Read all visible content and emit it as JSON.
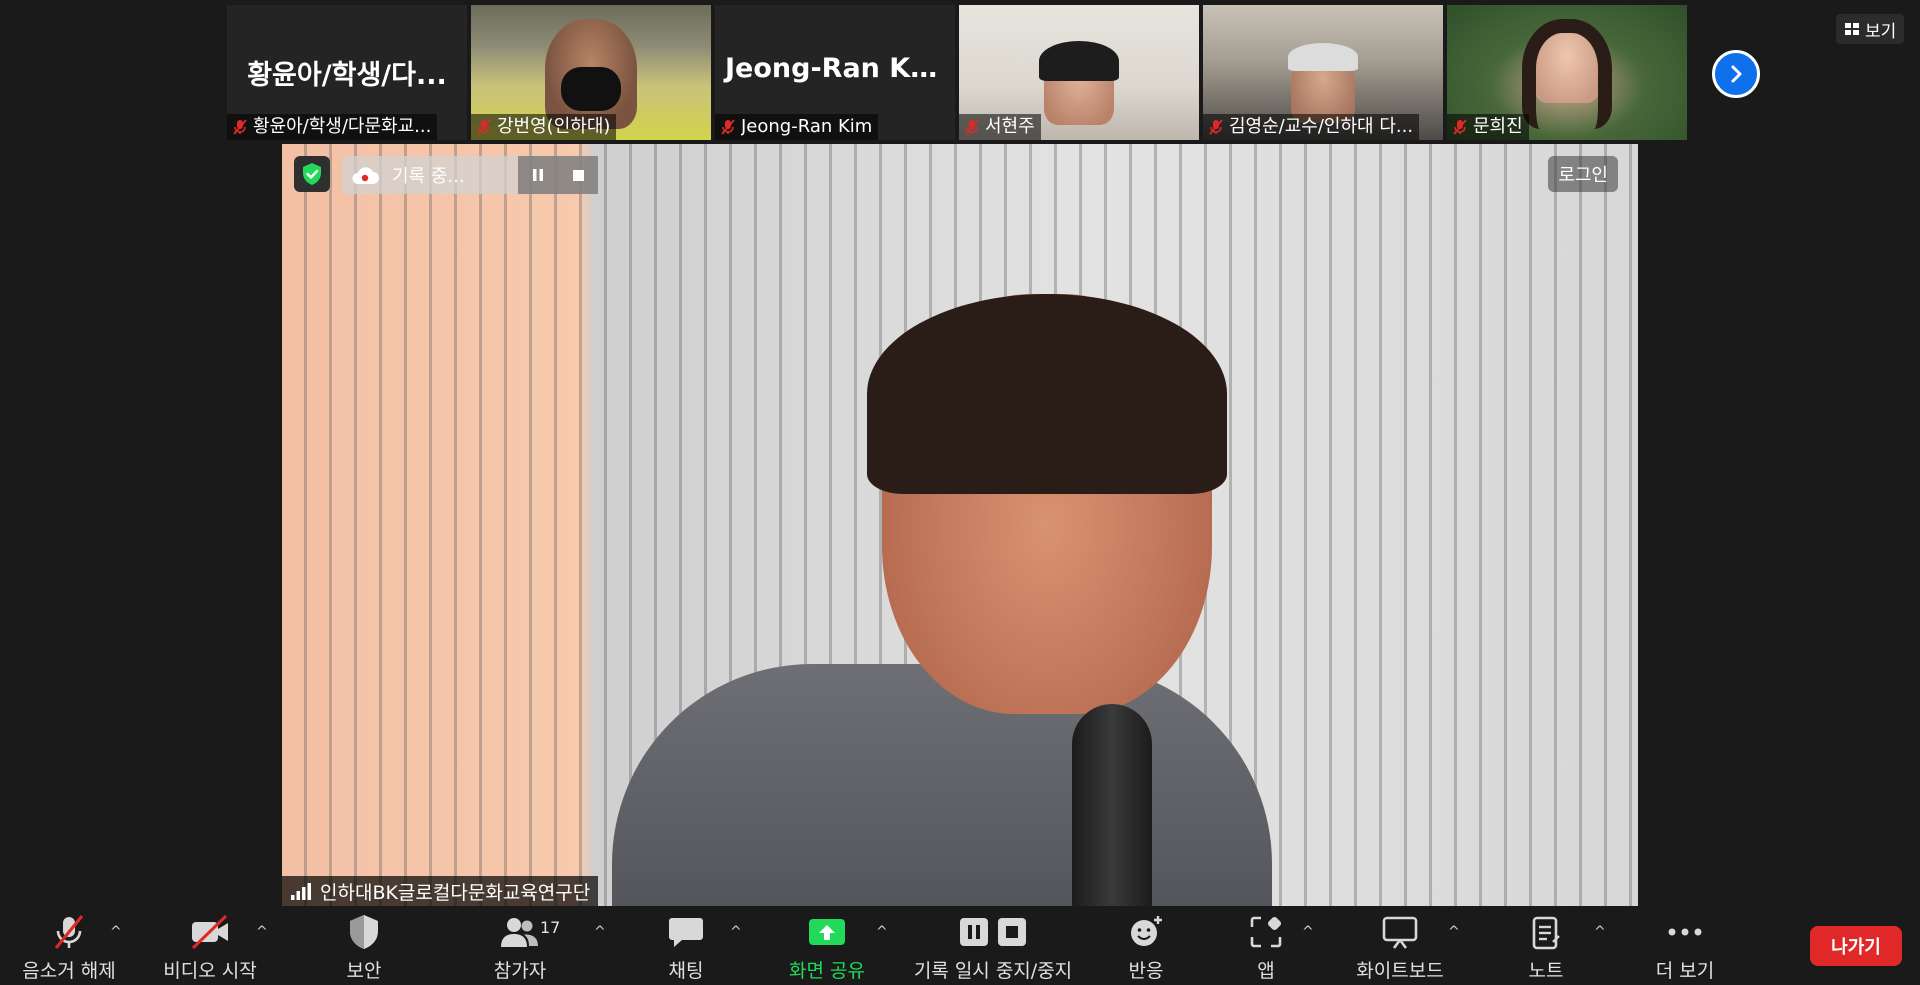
{
  "participants": [
    {
      "name": "황윤아/학생/다문화교...",
      "big_name": "황윤아/학생/다...",
      "video": false
    },
    {
      "name": "강번영(인하대)",
      "video": true
    },
    {
      "name": "Jeong-Ran Kim",
      "big_name": "Jeong-Ran Kim",
      "video": false
    },
    {
      "name": "서현주",
      "video": true
    },
    {
      "name": "김영순/교수/인하대 다...",
      "video": true
    },
    {
      "name": "문희진",
      "video": true
    }
  ],
  "view_label": "보기",
  "main": {
    "recording_label": "기록 중...",
    "login_label": "로그인",
    "speaker_name": "인하대BK글로컬다문화교육연구단"
  },
  "toolbar": {
    "unmute": "음소거 해제",
    "start_video": "비디오 시작",
    "security": "보안",
    "participants": "참가자",
    "participants_count": "17",
    "chat": "채팅",
    "share_screen": "화면 공유",
    "recording": "기록 일시 중지/중지",
    "reactions": "반응",
    "apps": "앱",
    "whiteboard": "화이트보드",
    "notes": "노트",
    "more": "더 보기",
    "leave": "나가기"
  },
  "colors": {
    "accent_blue": "#0e71eb",
    "share_green": "#23d959",
    "leave_red": "#e02828",
    "mute_red": "#e02828"
  }
}
